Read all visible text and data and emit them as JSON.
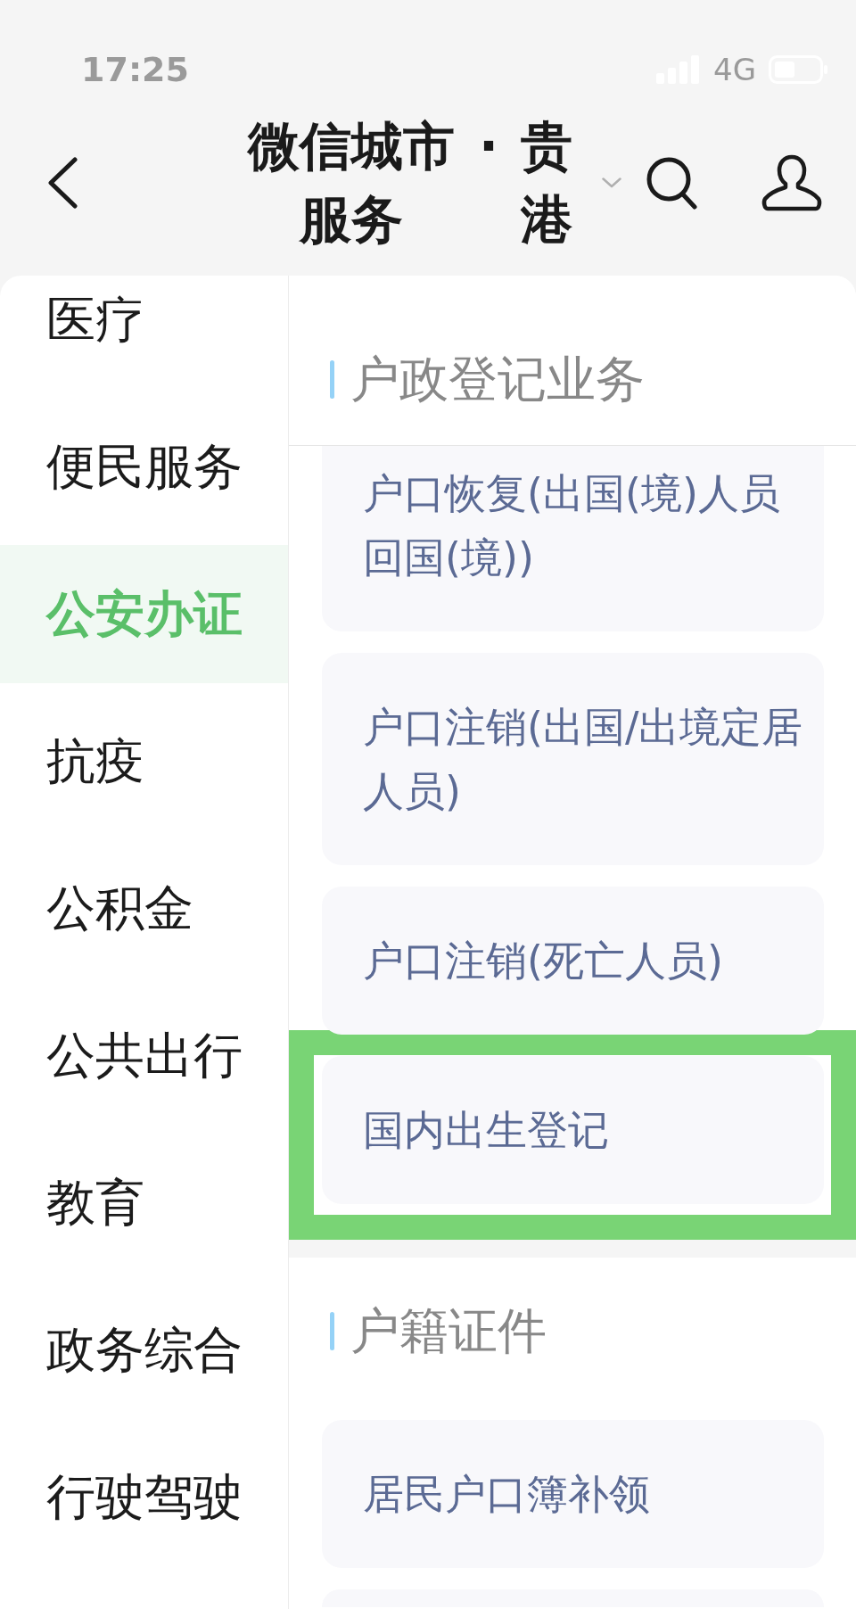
{
  "status_bar": {
    "time": "17:25",
    "network": "4G"
  },
  "header": {
    "title": "微信城市服务",
    "separator": "·",
    "city": "贵港"
  },
  "sidebar": {
    "items": [
      {
        "label": "医疗",
        "selected": false
      },
      {
        "label": "便民服务",
        "selected": false
      },
      {
        "label": "公安办证",
        "selected": true
      },
      {
        "label": "抗疫",
        "selected": false
      },
      {
        "label": "公积金",
        "selected": false
      },
      {
        "label": "公共出行",
        "selected": false
      },
      {
        "label": "教育",
        "selected": false
      },
      {
        "label": "政务综合",
        "selected": false
      },
      {
        "label": "行驶驾驶",
        "selected": false
      }
    ]
  },
  "sections": [
    {
      "title": "户政登记业务",
      "pinned": true,
      "items": [
        {
          "label": "户口恢复(出国(境)人员回国(境))",
          "highlighted": false
        },
        {
          "label": "户口注销(出国/出境定居人员)",
          "highlighted": false
        },
        {
          "label": "户口注销(死亡人员)",
          "highlighted": false
        },
        {
          "label": "国内出生登记",
          "highlighted": true
        }
      ]
    },
    {
      "title": "户籍证件",
      "pinned": false,
      "items": [
        {
          "label": "居民户口簿补领",
          "highlighted": false
        }
      ]
    }
  ]
}
